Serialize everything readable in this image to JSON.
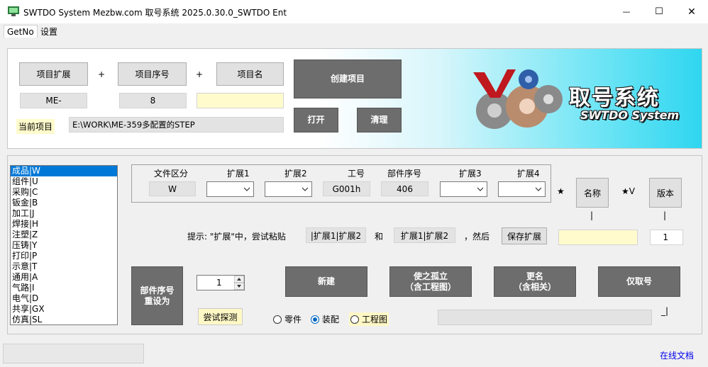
{
  "window": {
    "title": "SWTDO System Mezbw.com 取号系统  2025.0.30.0_SWTDO Ent",
    "minimize": "—",
    "maximize": "☐",
    "close": "✕"
  },
  "menu": {
    "items": [
      "GetNo",
      "设置"
    ]
  },
  "top": {
    "btn_project_ext": "项目扩展",
    "plus1": "+",
    "btn_project_seq": "项目序号",
    "plus2": "+",
    "btn_project_name": "项目名",
    "project_ext_value": "ME-",
    "project_seq_value": "8",
    "project_name_value": "",
    "btn_create": "创建项目",
    "btn_open": "打开",
    "btn_clear": "清理",
    "current_project_label": "当前项目",
    "current_project_path": "E:\\WORK\\ME-359多配置的STEP",
    "logo_title": "取号系统",
    "logo_subtitle": "SWTDO System"
  },
  "categories": [
    "成品|W",
    "组件|U",
    "采购|C",
    "钣金|B",
    "加工|J",
    "焊接|H",
    "注塑|Z",
    "压铸|Y",
    "打印|P",
    "示意|T",
    "通用|A",
    "气路|I",
    "电气|D",
    "共享|GX",
    "仿真|SL"
  ],
  "fields": {
    "file_type_label": "文件区分",
    "file_type_value": "W",
    "ext1_label": "扩展1",
    "ext2_label": "扩展2",
    "job_no_label": "工号",
    "job_no_value": "G001h",
    "part_seq_label": "部件序号",
    "part_seq_value": "406",
    "ext3_label": "扩展3",
    "ext4_label": "扩展4"
  },
  "right_controls": {
    "star1": "★",
    "btn_name": "名称",
    "star_v": "★V",
    "btn_version": "版本",
    "bar1": "|",
    "bar2": "|"
  },
  "hint": {
    "text": "提示: \"扩展\"中，尝试粘贴",
    "chip1": "|扩展1|扩展2",
    "and": "和",
    "chip2": "扩展1|扩展2",
    "then": "，然后",
    "btn_save_ext": "保存扩展",
    "save_value": "",
    "count_value": "1"
  },
  "actions": {
    "btn_reset_seq": "部件序号\n重设为",
    "spinner_value": "1",
    "btn_try_probe": "尝试探测",
    "btn_new": "新建",
    "btn_isolate": "使之孤立\n（含工程图）",
    "btn_rename": "更名\n（含相关）",
    "btn_get_no": "仅取号",
    "radio_part": "零件",
    "radio_assembly": "装配",
    "radio_drawing": "工程图",
    "selected_radio": "装配",
    "corner_mark": "_|"
  },
  "status": {
    "online_doc": "在线文档"
  },
  "colors": {
    "selection": "#0078d7",
    "dark_button": "#6d6d6d",
    "yellow_field": "#fffbcc",
    "gradient_end": "#2fd6f0",
    "link": "#0000ee"
  }
}
